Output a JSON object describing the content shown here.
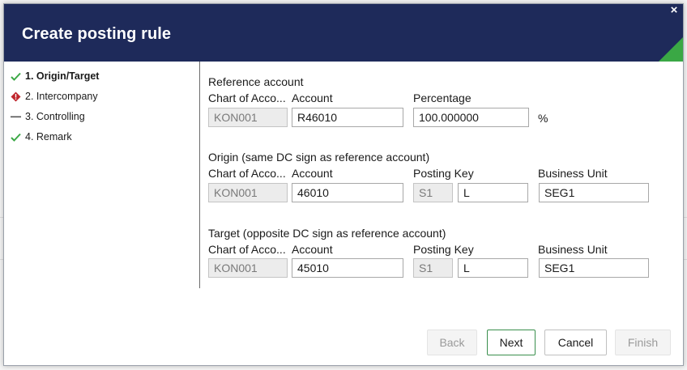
{
  "dialog": {
    "title": "Create posting rule",
    "close_glyph": "×"
  },
  "steps": [
    {
      "label": "1. Origin/Target",
      "status": "done",
      "icon": "check-icon",
      "active": true
    },
    {
      "label": "2. Intercompany",
      "status": "error",
      "icon": "error-icon",
      "active": false
    },
    {
      "label": "3. Controlling",
      "status": "pending",
      "icon": "dash-icon",
      "active": false
    },
    {
      "label": "4. Remark",
      "status": "done",
      "icon": "check-icon",
      "active": false
    }
  ],
  "reference": {
    "title": "Reference account",
    "chart_label": "Chart of Acco...",
    "account_label": "Account",
    "percentage_label": "Percentage",
    "chart_value": "KON001",
    "account_value": "R46010",
    "percentage_value": "100.000000",
    "percent_unit": "%"
  },
  "origin": {
    "title": "Origin (same DC sign as reference account)",
    "chart_label": "Chart of Acco...",
    "account_label": "Account",
    "posting_key_label": "Posting Key",
    "business_unit_label": "Business Unit",
    "chart_value": "KON001",
    "account_value": "46010",
    "posting_key_code": "S1",
    "posting_key_value": "L",
    "business_unit_value": "SEG1"
  },
  "target": {
    "title": "Target (opposite DC sign as reference account)",
    "chart_label": "Chart of Acco...",
    "account_label": "Account",
    "posting_key_label": "Posting Key",
    "business_unit_label": "Business Unit",
    "chart_value": "KON001",
    "account_value": "45010",
    "posting_key_code": "S1",
    "posting_key_value": "L",
    "business_unit_value": "SEG1"
  },
  "buttons": {
    "back": "Back",
    "next": "Next",
    "cancel": "Cancel",
    "finish": "Finish"
  },
  "colors": {
    "header_bg": "#1e2a5a",
    "accent_green": "#3aa845",
    "error_red": "#c0262d"
  }
}
